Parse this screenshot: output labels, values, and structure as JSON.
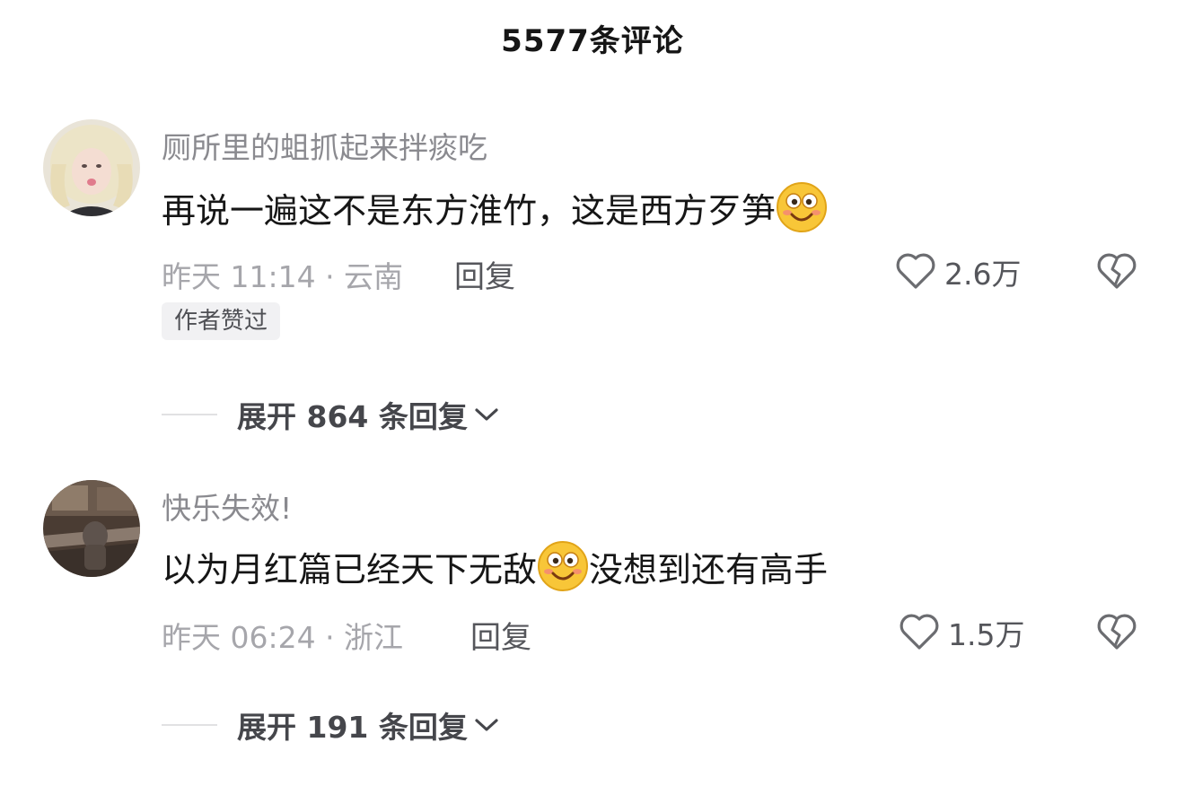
{
  "header": {
    "title": "5577条评论"
  },
  "comments": [
    {
      "username": "厕所里的蛆抓起来拌痰吃",
      "text_before": "再说一遍这不是东方淮竹，这是西方歹笋",
      "text_after": "",
      "emoji": "grinning-face-emoji",
      "time_location": "昨天 11:14 · 云南",
      "reply_label": "回复",
      "like_count": "2.6万",
      "author_badge": "作者赞过",
      "expand_label": "展开 864 条回复"
    },
    {
      "username": "快乐失效!",
      "text_before": "以为月红篇已经天下无敌",
      "text_after": "没想到还有高手",
      "emoji": "grinning-face-emoji",
      "time_location": "昨天 06:24 · 浙江",
      "reply_label": "回复",
      "like_count": "1.5万",
      "author_badge": "",
      "expand_label": "展开 191 条回复"
    }
  ],
  "icons": {
    "like": "heart-outline-icon",
    "dislike": "broken-heart-icon",
    "expand": "chevron-down-icon"
  },
  "colors": {
    "username": "#8a8a8f",
    "meta": "#a6a6ab",
    "badge_bg": "#f1f1f3"
  }
}
